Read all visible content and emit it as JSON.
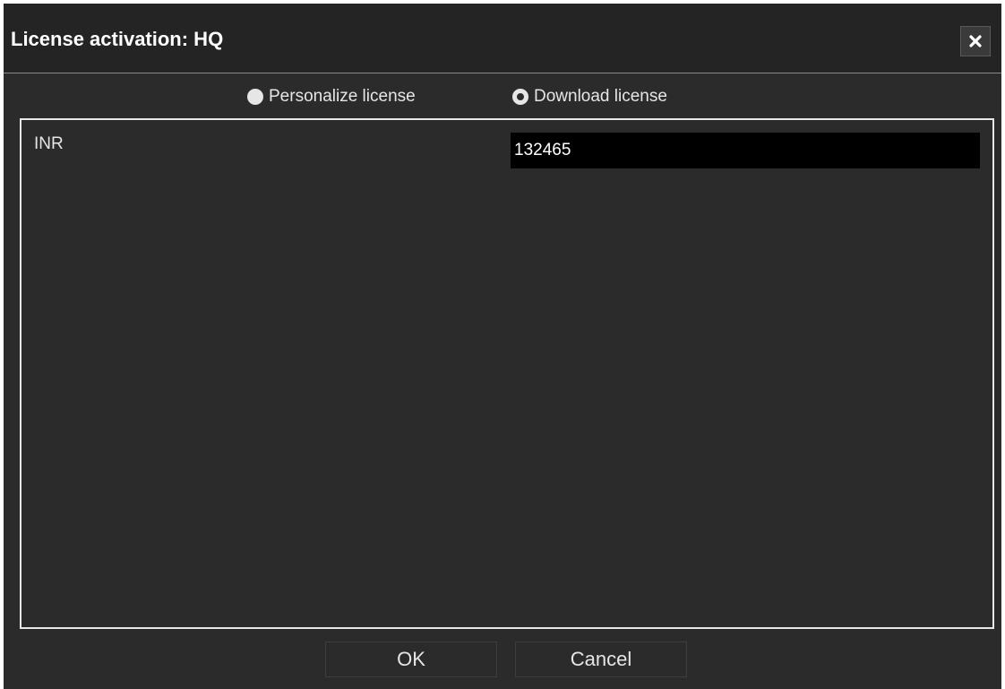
{
  "window": {
    "title": "License activation: HQ",
    "close_icon": "close-icon"
  },
  "mode": {
    "options": [
      {
        "label": "Personalize license",
        "selected": false
      },
      {
        "label": "Download license",
        "selected": true
      }
    ]
  },
  "form": {
    "inr_label": "INR",
    "inr_value": "132465"
  },
  "footer": {
    "ok_label": "OK",
    "cancel_label": "Cancel"
  },
  "colors": {
    "background": "#2b2b2b",
    "titlebar": "#242424",
    "text": "#e6e6e6",
    "input_background": "#000000"
  }
}
